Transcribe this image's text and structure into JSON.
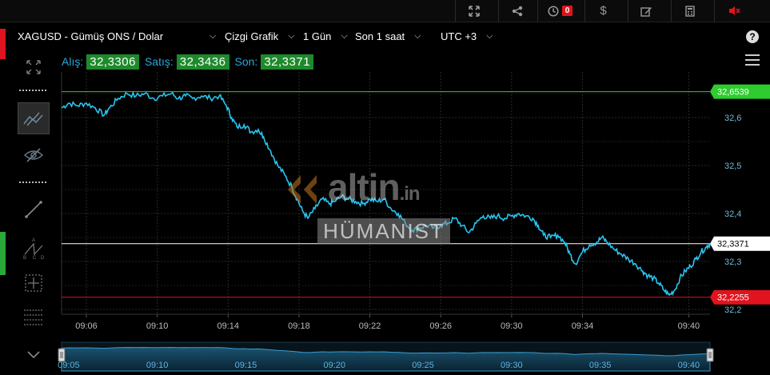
{
  "topbar": {
    "alarm_count": "0",
    "icons": [
      "expand-icon",
      "share-icon",
      "clock-icon",
      "dollar-icon",
      "edit-icon",
      "calculator-icon",
      "mute-icon"
    ]
  },
  "header": {
    "symbol": "XAGUSD - Gümüş ONS / Dolar",
    "chart_type": "Çizgi Grafik",
    "period": "1 Gün",
    "range": "Son 1 saat",
    "timezone": "UTC +3"
  },
  "prices": {
    "bid_label": "Alış:",
    "bid": "32,3306",
    "ask_label": "Satış:",
    "ask": "32,3436",
    "last_label": "Son:",
    "last": "32,3371"
  },
  "watermark": {
    "logo_text": "altin",
    "logo_suffix": ".in",
    "sub_text": "HÜMANIST"
  },
  "chart_data": {
    "type": "line",
    "line_color": "#29c5f0",
    "ylim": [
      32.19,
      32.695
    ],
    "y_ticks": [
      "32,6",
      "32,5",
      "32,4",
      "32,3",
      "32,2"
    ],
    "x_ticks": [
      "09:06",
      "09:10",
      "09:14",
      "09:18",
      "09:22",
      "09:26",
      "09:30",
      "09:34",
      "09:40"
    ],
    "x_tick_minutes": [
      6,
      10,
      14,
      18,
      22,
      26,
      30,
      34,
      40
    ],
    "x_start_minute": 4.6,
    "x_end_minute": 41.2,
    "reference_lines": [
      {
        "label": "32,6539",
        "value": 32.6539,
        "color": "#2ecc2e",
        "text_color": "#ffffff"
      },
      {
        "label": "32,3371",
        "value": 32.3371,
        "color": "#ffffff",
        "text_color": "#000000"
      },
      {
        "label": "32,2255",
        "value": 32.2255,
        "color": "#e0141e",
        "text_color": "#ffffff"
      }
    ],
    "series": [
      {
        "points": [
          [
            4.6,
            32.62
          ],
          [
            5.0,
            32.63
          ],
          [
            5.5,
            32.625
          ],
          [
            6.0,
            32.63
          ],
          [
            6.5,
            32.62
          ],
          [
            7.0,
            32.605
          ],
          [
            7.3,
            32.62
          ],
          [
            7.8,
            32.64
          ],
          [
            8.3,
            32.65
          ],
          [
            8.8,
            32.645
          ],
          [
            9.3,
            32.65
          ],
          [
            9.8,
            32.64
          ],
          [
            10.3,
            32.645
          ],
          [
            10.8,
            32.65
          ],
          [
            11.2,
            32.64
          ],
          [
            11.6,
            32.645
          ],
          [
            12.0,
            32.64
          ],
          [
            12.5,
            32.645
          ],
          [
            13.0,
            32.64
          ],
          [
            13.5,
            32.645
          ],
          [
            13.9,
            32.625
          ],
          [
            14.2,
            32.6
          ],
          [
            14.5,
            32.58
          ],
          [
            14.9,
            32.585
          ],
          [
            15.3,
            32.57
          ],
          [
            15.7,
            32.575
          ],
          [
            16.0,
            32.56
          ],
          [
            16.4,
            32.53
          ],
          [
            16.8,
            32.5
          ],
          [
            17.2,
            32.48
          ],
          [
            17.6,
            32.455
          ],
          [
            17.9,
            32.43
          ],
          [
            18.2,
            32.405
          ],
          [
            18.5,
            32.39
          ],
          [
            18.9,
            32.41
          ],
          [
            19.3,
            32.43
          ],
          [
            19.7,
            32.42
          ],
          [
            20.0,
            32.425
          ],
          [
            20.4,
            32.435
          ],
          [
            20.8,
            32.43
          ],
          [
            21.2,
            32.425
          ],
          [
            21.6,
            32.42
          ],
          [
            22.0,
            32.43
          ],
          [
            22.4,
            32.425
          ],
          [
            22.8,
            32.43
          ],
          [
            23.2,
            32.41
          ],
          [
            23.6,
            32.4
          ],
          [
            24.0,
            32.38
          ],
          [
            24.4,
            32.365
          ],
          [
            24.8,
            32.37
          ],
          [
            25.2,
            32.375
          ],
          [
            25.6,
            32.37
          ],
          [
            26.0,
            32.375
          ],
          [
            26.4,
            32.38
          ],
          [
            26.8,
            32.39
          ],
          [
            27.2,
            32.375
          ],
          [
            27.6,
            32.36
          ],
          [
            28.0,
            32.38
          ],
          [
            28.4,
            32.395
          ],
          [
            28.8,
            32.39
          ],
          [
            29.2,
            32.395
          ],
          [
            29.6,
            32.39
          ],
          [
            30.0,
            32.395
          ],
          [
            30.4,
            32.4
          ],
          [
            30.8,
            32.395
          ],
          [
            31.2,
            32.39
          ],
          [
            31.5,
            32.375
          ],
          [
            31.8,
            32.355
          ],
          [
            32.2,
            32.35
          ],
          [
            32.6,
            32.355
          ],
          [
            33.0,
            32.34
          ],
          [
            33.3,
            32.315
          ],
          [
            33.6,
            32.295
          ],
          [
            34.0,
            32.32
          ],
          [
            34.4,
            32.335
          ],
          [
            34.8,
            32.34
          ],
          [
            35.1,
            32.35
          ],
          [
            35.4,
            32.34
          ],
          [
            35.8,
            32.325
          ],
          [
            36.2,
            32.315
          ],
          [
            36.6,
            32.305
          ],
          [
            37.0,
            32.295
          ],
          [
            37.4,
            32.28
          ],
          [
            37.7,
            32.27
          ],
          [
            38.0,
            32.265
          ],
          [
            38.3,
            32.255
          ],
          [
            38.6,
            32.24
          ],
          [
            38.9,
            32.23
          ],
          [
            39.2,
            32.24
          ],
          [
            39.5,
            32.265
          ],
          [
            39.8,
            32.28
          ],
          [
            40.1,
            32.29
          ],
          [
            40.4,
            32.305
          ],
          [
            40.7,
            32.32
          ],
          [
            41.0,
            32.33
          ],
          [
            41.2,
            32.337
          ]
        ]
      }
    ],
    "navigator": {
      "x_ticks": [
        "09:05",
        "09:10",
        "09:15",
        "09:20",
        "09:25",
        "09:30",
        "09:35",
        "09:40"
      ],
      "x_tick_minutes": [
        5,
        10,
        15,
        20,
        25,
        30,
        35,
        40
      ]
    }
  }
}
